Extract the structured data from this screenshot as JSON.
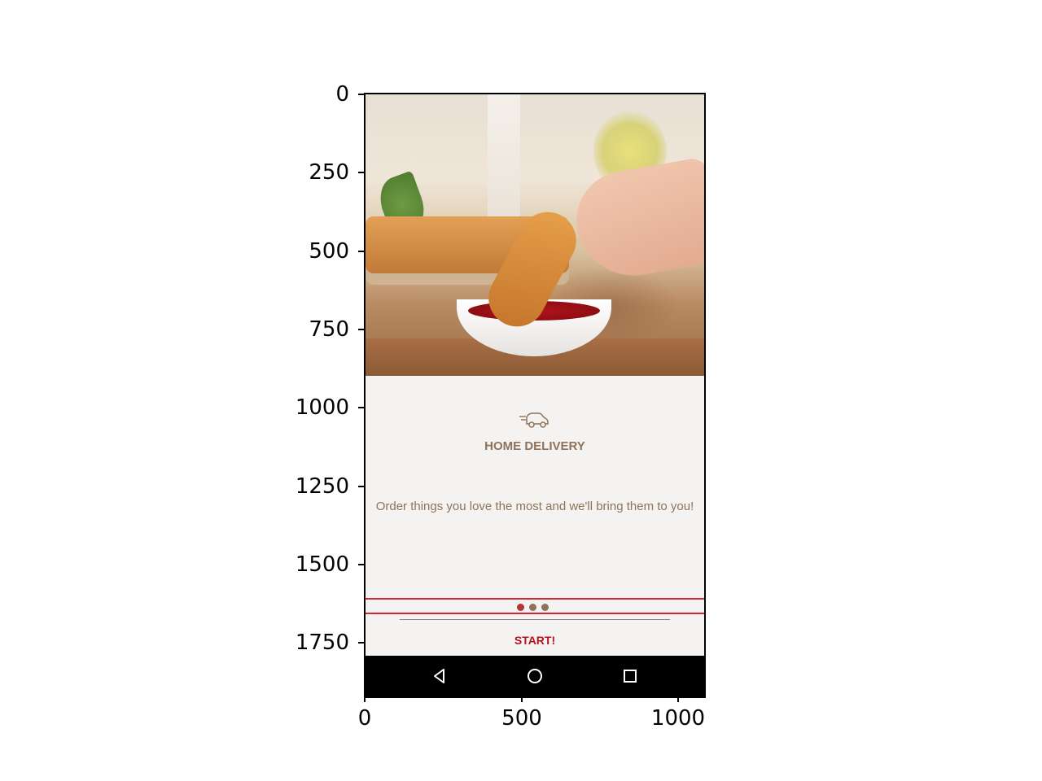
{
  "plot_axes": {
    "y_ticks": [
      "0",
      "250",
      "500",
      "750",
      "1000",
      "1250",
      "1500",
      "1750"
    ],
    "x_ticks": [
      "0",
      "500",
      "1000"
    ]
  },
  "screen": {
    "hero_image": "chicken-tender-dipped-in-ketchup-photo",
    "feature": {
      "icon": "delivery-truck-icon",
      "title": "HOME DELIVERY",
      "description": "Order things you love the most and we'll bring them to you!"
    },
    "pager": {
      "page_count": 3,
      "active_index": 0,
      "colors": {
        "active": "#b3363a",
        "inactive": "#8f7257"
      }
    },
    "start_label": "START!",
    "highlight_color": "#d6262d",
    "nav_bar": {
      "buttons": [
        "back-icon",
        "home-icon",
        "recents-icon"
      ]
    }
  }
}
